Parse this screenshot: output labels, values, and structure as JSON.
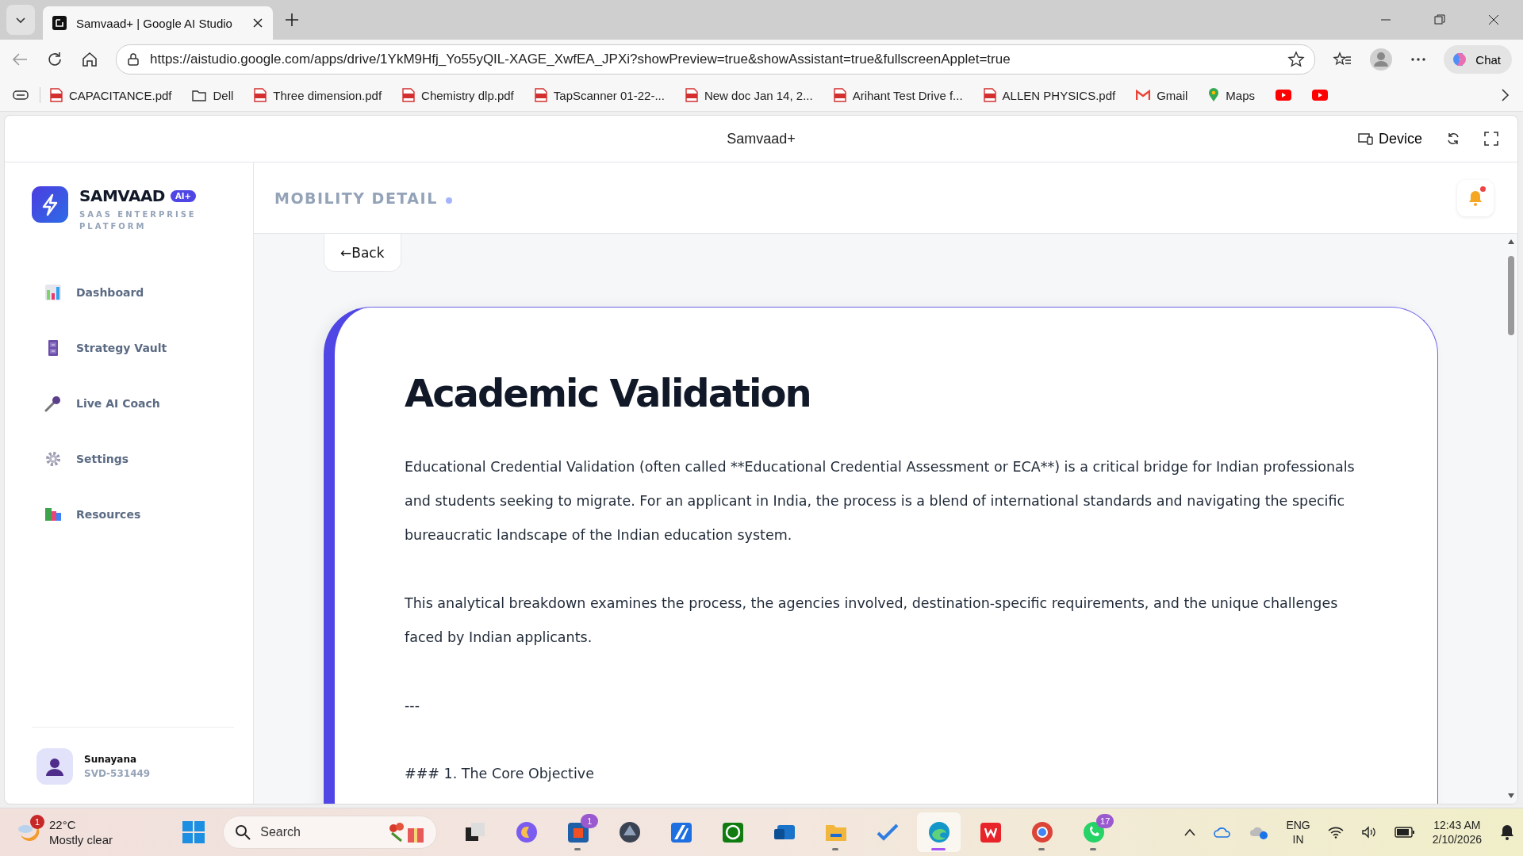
{
  "browser": {
    "tabs": [
      {
        "title": "Samvaad+ | Google AI Studio",
        "selected": true
      }
    ],
    "url": "https://aistudio.google.com/apps/drive/1YkM9Hfj_Yo55yQIL-XAGE_XwfEA_JPXi?showPreview=true&showAssistant=true&fullscreenApplet=true",
    "chat_button": "Chat",
    "bookmarks": [
      {
        "kind": "pdf",
        "label": "CAPACITANCE.pdf"
      },
      {
        "kind": "folder",
        "label": "Dell"
      },
      {
        "kind": "pdf",
        "label": "Three dimension.pdf"
      },
      {
        "kind": "pdf",
        "label": "Chemistry dlp.pdf"
      },
      {
        "kind": "pdf",
        "label": "TapScanner 01-22-..."
      },
      {
        "kind": "pdf",
        "label": "New doc Jan 14, 2..."
      },
      {
        "kind": "pdf",
        "label": "Arihant Test Drive f..."
      },
      {
        "kind": "pdf",
        "label": "ALLEN PHYSICS.pdf"
      },
      {
        "kind": "mail",
        "label": "Gmail"
      },
      {
        "kind": "pin",
        "label": "Maps"
      },
      {
        "kind": "video"
      },
      {
        "kind": "video"
      }
    ]
  },
  "app": {
    "title": "Samvaad+",
    "device_button": "Device"
  },
  "sidebar": {
    "brand": "SAMVAAD",
    "badge": "AI+",
    "subtitle": "SAAS ENTERPRISE PLATFORM",
    "items": [
      {
        "kind": "chart",
        "label": "Dashboard",
        "selected": false
      },
      {
        "kind": "cabinet",
        "label": "Strategy Vault",
        "selected": false
      },
      {
        "kind": "mic",
        "label": "Live AI Coach",
        "selected": false
      },
      {
        "kind": "gear",
        "label": "Settings",
        "selected": false
      },
      {
        "kind": "books",
        "label": "Resources",
        "selected": false
      }
    ],
    "user": {
      "name": "Sunayana",
      "id": "SVD-531449"
    }
  },
  "header": {
    "title": "MOBILITY DETAIL",
    "unread": true
  },
  "back_button": "←Back",
  "article": {
    "title": "Academic Validation",
    "paragraphs": [
      "Educational Credential Validation (often called **Educational Credential Assessment or ECA**) is a critical bridge for Indian professionals and students seeking to migrate. For an applicant in India, the process is a blend of international standards and navigating the specific bureaucratic landscape of the Indian education system.",
      "This analytical breakdown examines the process, the agencies involved, destination-specific requirements, and the unique challenges faced by Indian applicants.",
      "---",
      "### 1. The Core Objective"
    ]
  },
  "taskbar": {
    "weather": {
      "temp": "22°C",
      "condition": "Mostly clear",
      "badge": "1"
    },
    "search_placeholder": "Search",
    "apps": [
      {
        "kind": "squares",
        "running": false,
        "active": false
      },
      {
        "kind": "swirl",
        "running": false,
        "active": false
      },
      {
        "kind": "bag",
        "badge": "1",
        "running": true,
        "active": false
      },
      {
        "kind": "gem",
        "running": false,
        "active": false
      },
      {
        "kind": "blue",
        "running": false,
        "active": false
      },
      {
        "kind": "xbox",
        "running": false,
        "active": false
      },
      {
        "kind": "mailbox",
        "running": false,
        "active": false
      },
      {
        "kind": "folder",
        "running": true,
        "active": false
      },
      {
        "kind": "check",
        "running": false,
        "active": false
      },
      {
        "kind": "wave",
        "running": true,
        "active": true
      },
      {
        "kind": "wps",
        "running": false,
        "active": false
      },
      {
        "kind": "ring",
        "running": true,
        "active": false
      },
      {
        "kind": "phone",
        "badge": "17",
        "running": true,
        "active": false
      }
    ],
    "language": "ENG",
    "region": "IN",
    "time": "12:43 AM",
    "date": "2/10/2026"
  }
}
